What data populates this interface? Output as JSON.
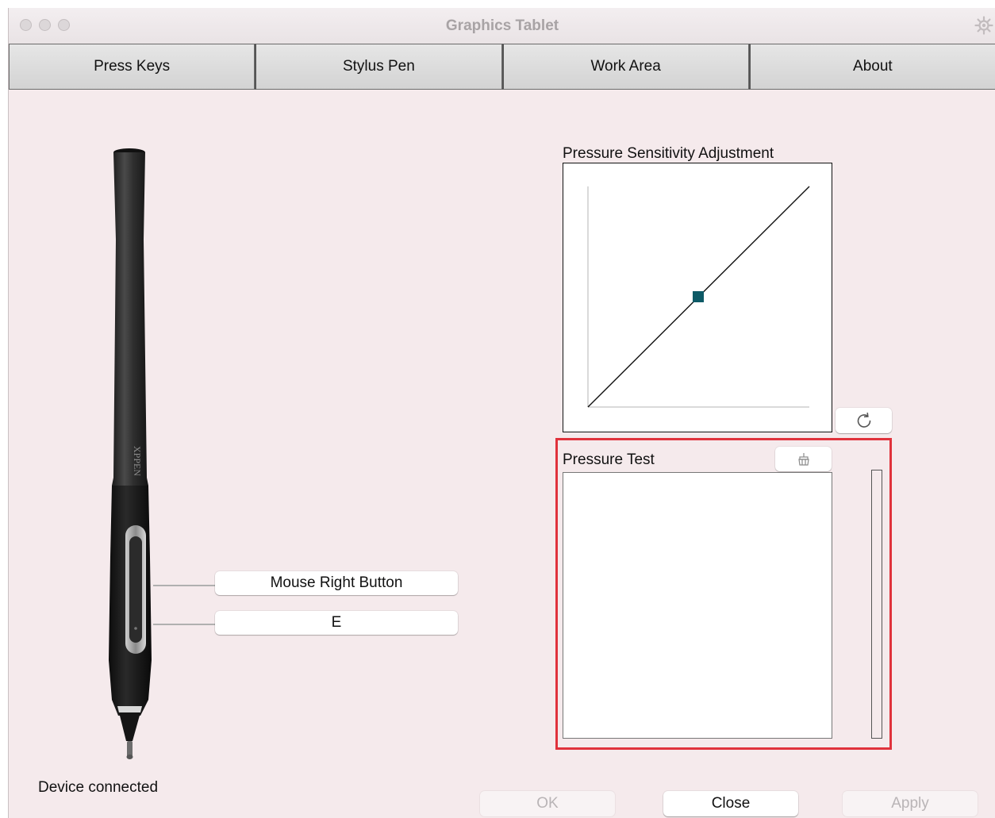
{
  "window": {
    "title": "Graphics Tablet"
  },
  "tabs": [
    {
      "label": "Press Keys"
    },
    {
      "label": "Stylus Pen"
    },
    {
      "label": "Work Area"
    },
    {
      "label": "About"
    }
  ],
  "pen": {
    "brand_text": "XPPEN",
    "buttons": [
      {
        "value": "Mouse Right Button"
      },
      {
        "value": "E"
      }
    ]
  },
  "pressure_curve": {
    "label": "Pressure Sensitivity Adjustment",
    "control_point_color": "#0d5a66"
  },
  "pressure_test": {
    "label": "Pressure Test",
    "highlight_color": "#e0323c",
    "level": 0
  },
  "status": {
    "text": "Device connected"
  },
  "footer": {
    "ok_label": "OK",
    "close_label": "Close",
    "apply_label": "Apply"
  },
  "icons": {
    "reset": "refresh-icon",
    "clear": "broom-icon",
    "settings": "gear-icon"
  }
}
